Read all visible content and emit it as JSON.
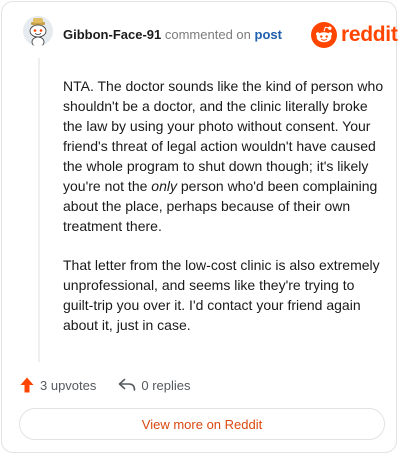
{
  "header": {
    "username": "Gibbon-Face-91",
    "commented_text": "commented on",
    "post_link": "post",
    "brand_name": "reddit"
  },
  "comment": {
    "paragraph1_before_em": "NTA. The doctor sounds like the kind of person who shouldn't be a doctor, and the clinic literally broke the law by using your photo without consent. Your friend's threat of legal action wouldn't have caused the whole program to shut down though; it's likely you're not the ",
    "paragraph1_em": "only",
    "paragraph1_after_em": " person who'd been complaining about the place, perhaps because of their own treatment there.",
    "paragraph2": "That letter from the low-cost clinic is also extremely unprofessional, and seems like they're trying to guilt-trip you over it. I'd contact your friend again about it, just in case."
  },
  "footer": {
    "upvotes": "3 upvotes",
    "replies": "0 replies"
  },
  "view_more_label": "View more on Reddit",
  "colors": {
    "brand": "#ff4500",
    "link": "#1f5fad",
    "view_more": "#d9480f"
  },
  "icons": {
    "avatar": "snoo-avatar-icon",
    "brand": "reddit-logo-icon",
    "upvote": "upvote-arrow-icon",
    "reply": "reply-arrow-icon"
  }
}
